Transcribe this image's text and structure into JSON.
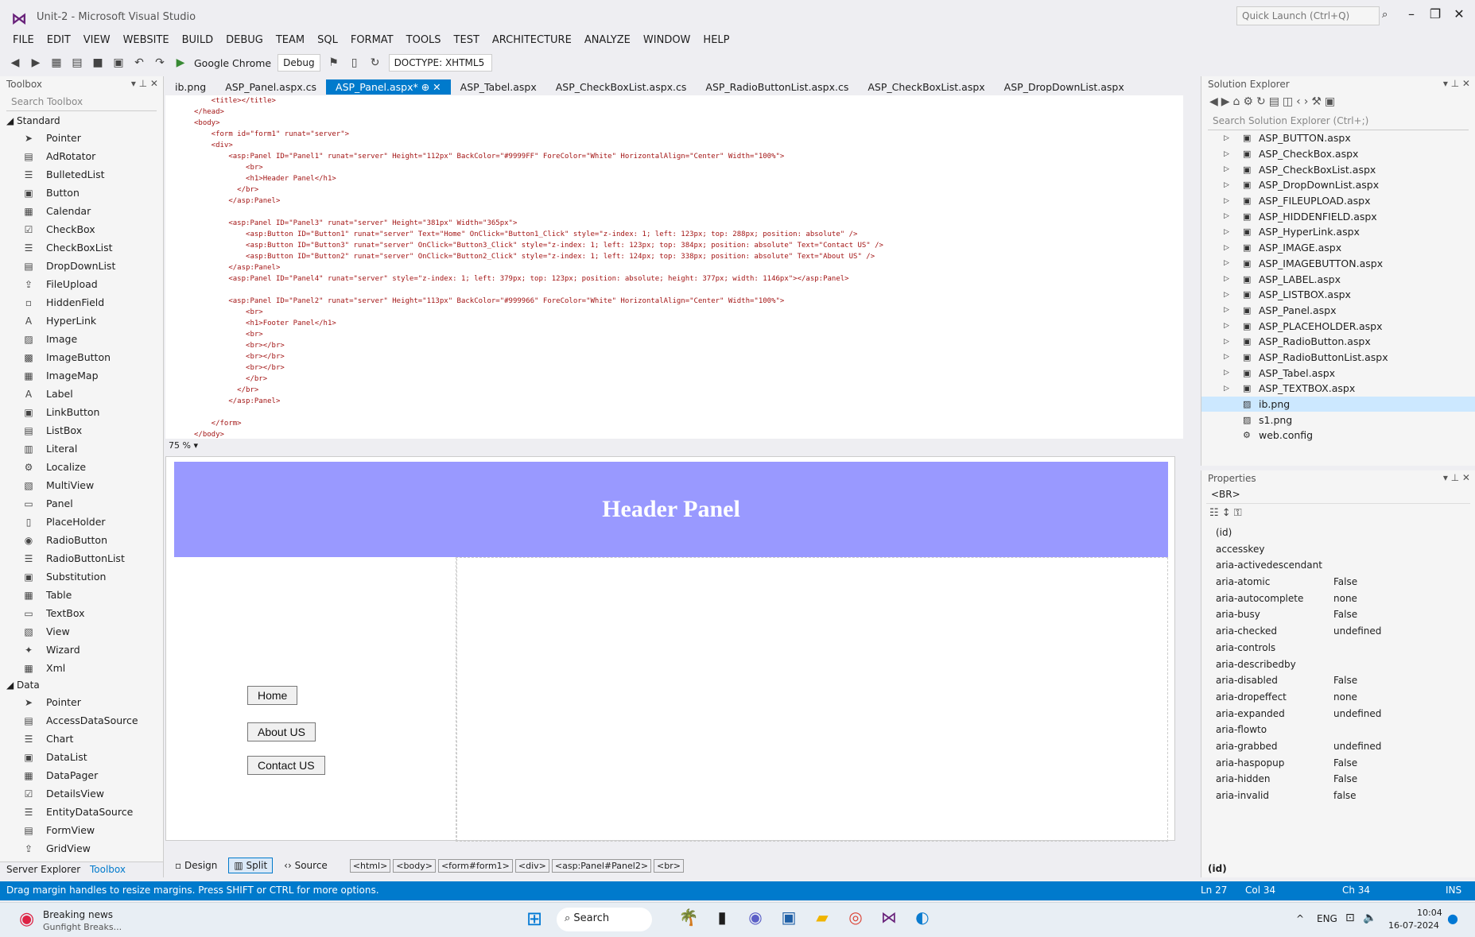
{
  "window": {
    "title": "Unit-2 - Microsoft Visual Studio",
    "quick_launch_placeholder": "Quick Launch (Ctrl+Q)"
  },
  "menu": [
    "FILE",
    "EDIT",
    "VIEW",
    "WEBSITE",
    "BUILD",
    "DEBUG",
    "TEAM",
    "SQL",
    "FORMAT",
    "TOOLS",
    "TEST",
    "ARCHITECTURE",
    "ANALYZE",
    "WINDOW",
    "HELP"
  ],
  "toolbar": {
    "run_target": "Google Chrome",
    "config": "Debug",
    "doctype": "DOCTYPE: XHTML5"
  },
  "toolbox": {
    "title": "Toolbox",
    "search_placeholder": "Search Toolbox",
    "standard_header": "Standard",
    "standard_items": [
      "Pointer",
      "AdRotator",
      "BulletedList",
      "Button",
      "Calendar",
      "CheckBox",
      "CheckBoxList",
      "DropDownList",
      "FileUpload",
      "HiddenField",
      "HyperLink",
      "Image",
      "ImageButton",
      "ImageMap",
      "Label",
      "LinkButton",
      "ListBox",
      "Literal",
      "Localize",
      "MultiView",
      "Panel",
      "PlaceHolder",
      "RadioButton",
      "RadioButtonList",
      "Substitution",
      "Table",
      "TextBox",
      "View",
      "Wizard",
      "Xml"
    ],
    "data_header": "Data",
    "data_items": [
      "Pointer",
      "AccessDataSource",
      "Chart",
      "DataList",
      "DataPager",
      "DetailsView",
      "EntityDataSource",
      "FormView",
      "GridView"
    ],
    "footer_left": "Server Explorer",
    "footer_right": "Toolbox"
  },
  "tabs": [
    {
      "label": "ib.png",
      "active": false
    },
    {
      "label": "ASP_Panel.aspx.cs",
      "active": false
    },
    {
      "label": "ASP_Panel.aspx*",
      "active": true
    },
    {
      "label": "ASP_Tabel.aspx",
      "active": false
    },
    {
      "label": "ASP_CheckBoxList.aspx.cs",
      "active": false
    },
    {
      "label": "ASP_RadioButtonList.aspx.cs",
      "active": false
    },
    {
      "label": "ASP_CheckBoxList.aspx",
      "active": false
    },
    {
      "label": "ASP_DropDownList.aspx",
      "active": false
    }
  ],
  "code_lines": [
    "    <title></title>",
    "</head>",
    "<body>",
    "    <form id=\"form1\" runat=\"server\">",
    "    <div>",
    "        <asp:Panel ID=\"Panel1\" runat=\"server\" Height=\"112px\" BackColor=\"#9999FF\" ForeColor=\"White\" HorizontalAlign=\"Center\" Width=\"100%\">",
    "            <br>",
    "            <h1>Header Panel</h1>",
    "          </br>",
    "        </asp:Panel>",
    "",
    "        <asp:Panel ID=\"Panel3\" runat=\"server\" Height=\"381px\" Width=\"365px\">",
    "            <asp:Button ID=\"Button1\" runat=\"server\" Text=\"Home\" OnClick=\"Button1_Click\" style=\"z-index: 1; left: 123px; top: 288px; position: absolute\" />",
    "            <asp:Button ID=\"Button3\" runat=\"server\" OnClick=\"Button3_Click\" style=\"z-index: 1; left: 123px; top: 384px; position: absolute\" Text=\"Contact US\" />",
    "            <asp:Button ID=\"Button2\" runat=\"server\" OnClick=\"Button2_Click\" style=\"z-index: 1; left: 124px; top: 338px; position: absolute\" Text=\"About US\" />",
    "        </asp:Panel>",
    "        <asp:Panel ID=\"Panel4\" runat=\"server\" style=\"z-index: 1; left: 379px; top: 123px; position: absolute; height: 377px; width: 1146px\"></asp:Panel>",
    "",
    "        <asp:Panel ID=\"Panel2\" runat=\"server\" Height=\"113px\" BackColor=\"#999966\" ForeColor=\"White\" HorizontalAlign=\"Center\" Width=\"100%\">",
    "            <br>",
    "            <h1>Footer Panel</h1>",
    "            <br>",
    "            <br></br>",
    "            <br></br>",
    "            <br></br>",
    "            </br>",
    "          </br>",
    "        </asp:Panel>",
    "",
    "    </form>",
    "</body>"
  ],
  "editor_zoom": "75 %",
  "design": {
    "header_text": "Header Panel",
    "buttons": [
      "Home",
      "About US",
      "Contact US"
    ],
    "header_color": "#9999ff"
  },
  "viewbar": {
    "design": "Design",
    "split": "Split",
    "source": "Source",
    "crumbs": [
      "<html>",
      "<body>",
      "<form#form1>",
      "<div>",
      "<asp:Panel#Panel2>",
      "<br>"
    ]
  },
  "solution_explorer": {
    "title": "Solution Explorer",
    "search_placeholder": "Search Solution Explorer (Ctrl+;)",
    "items": [
      {
        "label": "ASP_BUTTON.aspx",
        "type": "aspx"
      },
      {
        "label": "ASP_CheckBox.aspx",
        "type": "aspx"
      },
      {
        "label": "ASP_CheckBoxList.aspx",
        "type": "aspx"
      },
      {
        "label": "ASP_DropDownList.aspx",
        "type": "aspx"
      },
      {
        "label": "ASP_FILEUPLOAD.aspx",
        "type": "aspx"
      },
      {
        "label": "ASP_HIDDENFIELD.aspx",
        "type": "aspx"
      },
      {
        "label": "ASP_HyperLink.aspx",
        "type": "aspx"
      },
      {
        "label": "ASP_IMAGE.aspx",
        "type": "aspx"
      },
      {
        "label": "ASP_IMAGEBUTTON.aspx",
        "type": "aspx"
      },
      {
        "label": "ASP_LABEL.aspx",
        "type": "aspx"
      },
      {
        "label": "ASP_LISTBOX.aspx",
        "type": "aspx"
      },
      {
        "label": "ASP_Panel.aspx",
        "type": "aspx"
      },
      {
        "label": "ASP_PLACEHOLDER.aspx",
        "type": "aspx"
      },
      {
        "label": "ASP_RadioButton.aspx",
        "type": "aspx"
      },
      {
        "label": "ASP_RadioButtonList.aspx",
        "type": "aspx"
      },
      {
        "label": "ASP_Tabel.aspx",
        "type": "aspx"
      },
      {
        "label": "ASP_TEXTBOX.aspx",
        "type": "aspx"
      },
      {
        "label": "ib.png",
        "type": "png",
        "selected": true
      },
      {
        "label": "s1.png",
        "type": "png"
      },
      {
        "label": "web.config",
        "type": "config"
      }
    ]
  },
  "properties": {
    "title": "Properties",
    "selected_object": "<BR>",
    "rows": [
      {
        "name": "(id)",
        "value": ""
      },
      {
        "name": "accesskey",
        "value": ""
      },
      {
        "name": "aria-activedescendant",
        "value": ""
      },
      {
        "name": "aria-atomic",
        "value": "False"
      },
      {
        "name": "aria-autocomplete",
        "value": "none"
      },
      {
        "name": "aria-busy",
        "value": "False"
      },
      {
        "name": "aria-checked",
        "value": "undefined"
      },
      {
        "name": "aria-controls",
        "value": ""
      },
      {
        "name": "aria-describedby",
        "value": ""
      },
      {
        "name": "aria-disabled",
        "value": "False"
      },
      {
        "name": "aria-dropeffect",
        "value": "none"
      },
      {
        "name": "aria-expanded",
        "value": "undefined"
      },
      {
        "name": "aria-flowto",
        "value": ""
      },
      {
        "name": "aria-grabbed",
        "value": "undefined"
      },
      {
        "name": "aria-haspopup",
        "value": "False"
      },
      {
        "name": "aria-hidden",
        "value": "False"
      },
      {
        "name": "aria-invalid",
        "value": "false"
      }
    ],
    "footer": "(id)"
  },
  "statusbar": {
    "message": "Drag margin handles to resize margins. Press SHIFT or CTRL for more options.",
    "ln": "Ln 27",
    "col": "Col 34",
    "ch": "Ch 34",
    "mode": "INS",
    "color": "#007acc"
  },
  "taskbar": {
    "news_title": "Breaking news",
    "news_sub": "Gunfight Breaks...",
    "search": "Search",
    "lang": "ENG",
    "time": "10:04",
    "date": "16-07-2024"
  }
}
